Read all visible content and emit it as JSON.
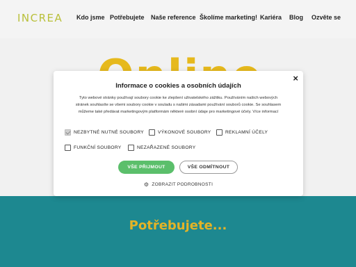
{
  "header": {
    "logo_main": "INCREA",
    "nav": [
      "Kdo jsme",
      "Potřebujete",
      "Naše reference",
      "Školíme marketing!",
      "Kariéra",
      "Blog",
      "Ozvěte se"
    ]
  },
  "hero": {
    "big_text": "Online"
  },
  "section": {
    "title": "Potřebujete..."
  },
  "modal": {
    "title": "Informace o cookies a osobních údajích",
    "text": "Tyto webové stránky používají soubory cookie ke zlepšení uživatelského zážitku. Používáním našich webových stránek souhlasíte se všemi soubory cookie v souladu s našimi zásadami používání souborů cookie. Se souhlasem můžeme také předávat marketingovým platformám některé osobní údaje pro marketingové účely. Více informací",
    "options": [
      {
        "label": "NEZBYTNÉ NUTNÉ SOUBORY",
        "checked": true
      },
      {
        "label": "VÝKONOVÉ SOUBORY",
        "checked": false
      },
      {
        "label": "REKLAMNÍ ÚČELY",
        "checked": false
      },
      {
        "label": "FUNKČNÍ SOUBORY",
        "checked": false
      },
      {
        "label": "NEZAŘAZENÉ SOUBORY",
        "checked": false
      }
    ],
    "accept_label": "VŠE PŘIJMOUT",
    "reject_label": "VŠE ODMÍTNOUT",
    "details_label": "ZOBRAZIT PODROBNOSTI",
    "close_symbol": "×"
  },
  "colors": {
    "teal": "#1d8890",
    "gold": "#e3b327",
    "accept_green": "#5bbf6b"
  }
}
